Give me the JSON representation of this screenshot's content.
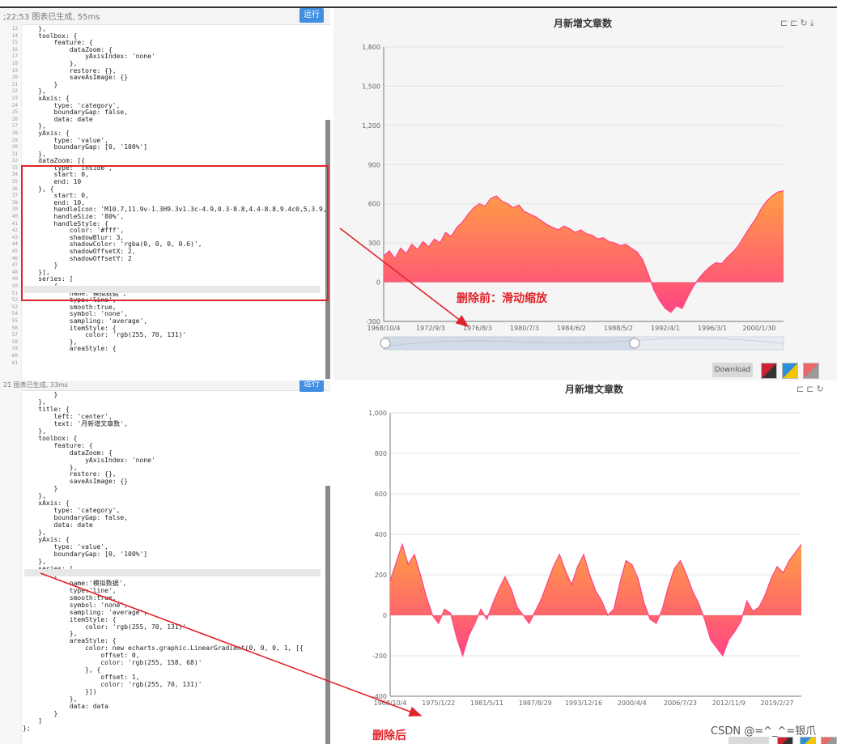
{
  "top_editor": {
    "status": ";22;53  图表已生成, 55ms",
    "run_label": "运行",
    "lines": [
      "    },",
      "    toolbox: {",
      "        feature: {",
      "            dataZoom: {",
      "                yAxisIndex: 'none'",
      "            },",
      "            restore: {},",
      "            saveAsImage: {}",
      "        }",
      "    },",
      "    xAxis: {",
      "        type: 'category',",
      "        boundaryGap: false,",
      "        data: date",
      "    },",
      "    yAxis: {",
      "        type: 'value',",
      "        boundaryGap: [0, '100%']",
      "    },",
      "    dataZoom: [{",
      "        type: 'inside',",
      "        start: 0,",
      "        end: 10",
      "    }, {",
      "        start: 0,",
      "        end: 10,",
      "        handleIcon: 'M10.7,11.9v-1.3H9.3v1.3c-4.9,0.3-8.8,4.4-8.8,9.4c0,5,3.9,9.1,8.8,9.",
      "        handleSize: '80%',",
      "        handleStyle: {",
      "            color: '#fff',",
      "            shadowBlur: 3,",
      "            shadowColor: 'rgba(0, 0, 0, 0.6)',",
      "            shadowOffsetX: 2,",
      "            shadowOffsetY: 2",
      "        }",
      "    }],",
      "    series: [",
      "        {",
      "            name:'模拟数据',",
      "            type:'line',",
      "            smooth:true,",
      "            symbol: 'none',",
      "            sampling: 'average',",
      "            itemStyle: {",
      "                color: 'rgb(255, 70, 131)'",
      "            },",
      "            areaStyle: {"
    ],
    "gutter": "13\n14\n15\n16\n17\n18\n19\n20\n21\n22\n23\n24\n25\n26\n27\n28\n29\n30\n31\n32\n33\n34\n35\n36\n37\n38\n39\n40\n41\n42\n43\n44\n45\n46\n47\n48\n49\n50\n51\n52\n53\n54\n55\n56\n57\n58\n59\n60\n61"
  },
  "bottom_editor": {
    "status": "21  图表已生成, 33ms",
    "run_label": "运行",
    "lines": [
      "        }",
      "    },",
      "    title: {",
      "        left: 'center',",
      "        text: '月新增文章数',",
      "    },",
      "    toolbox: {",
      "        feature: {",
      "            dataZoom: {",
      "                yAxisIndex: 'none'",
      "            },",
      "            restore: {},",
      "            saveAsImage: {}",
      "        }",
      "    },",
      "    xAxis: {",
      "        type: 'category',",
      "        boundaryGap: false,",
      "        data: date",
      "    },",
      "    yAxis: {",
      "        type: 'value',",
      "        boundaryGap: [0, '100%']",
      "    },",
      "    series: [",
      "        {",
      "            name:'模拟数据',",
      "            type:'line',",
      "            smooth:true,",
      "            symbol: 'none',",
      "            sampling: 'average',",
      "            itemStyle: {",
      "                color: 'rgb(255, 70, 131)'",
      "            },",
      "            areaStyle: {",
      "                color: new echarts.graphic.LinearGradient(0, 0, 0, 1, [{",
      "                    offset: 0,",
      "                    color: 'rgb(255, 158, 68)'",
      "                }, {",
      "                    offset: 1,",
      "                    color: 'rgb(255, 70, 131)'",
      "                }])",
      "            },",
      "            data: data",
      "        }",
      "    ]",
      "};"
    ]
  },
  "annotations": {
    "before": "删除前：滑动缩放",
    "after": "删除后"
  },
  "watermark": "CSDN @=^_^=银爪",
  "toolbar": {
    "download_label": "Download"
  },
  "colors": {
    "line": "#ff4683",
    "gradient_top": "#ff9e44",
    "gradient_bottom": "#ff4683",
    "annotation": "#e0242a",
    "run_button": "#3f8ee0"
  },
  "chart_data": [
    {
      "type": "area",
      "title": "月新增文章数",
      "ylim": [
        -300,
        1800
      ],
      "yticks": [
        -300,
        0,
        300,
        600,
        900,
        1200,
        1500,
        1800
      ],
      "ytick_labels": [
        "-300",
        "0",
        "300",
        "600",
        "900",
        "1,200",
        "1,500",
        "1,800"
      ],
      "xtick_labels": [
        "1968/10/4",
        "1972/9/3",
        "1976/8/3",
        "1980/7/3",
        "1984/6/2",
        "1988/5/2",
        "1992/4/1",
        "1996/3/1",
        "2000/1/30"
      ],
      "datazoom": {
        "start": 0,
        "end": 10
      },
      "values": [
        200,
        240,
        180,
        260,
        220,
        290,
        250,
        310,
        270,
        330,
        300,
        380,
        350,
        420,
        460,
        520,
        570,
        600,
        580,
        640,
        660,
        620,
        600,
        570,
        590,
        540,
        520,
        500,
        470,
        440,
        420,
        400,
        430,
        410,
        380,
        400,
        370,
        360,
        330,
        340,
        310,
        300,
        280,
        290,
        260,
        230,
        170,
        60,
        -60,
        -140,
        -200,
        -230,
        -180,
        -200,
        -110,
        -30,
        30,
        80,
        120,
        150,
        140,
        190,
        230,
        280,
        350,
        420,
        480,
        560,
        620,
        660,
        690,
        700
      ]
    },
    {
      "type": "area",
      "title": "月新增文章数",
      "ylim": [
        -400,
        1000
      ],
      "yticks": [
        -400,
        -200,
        0,
        200,
        400,
        600,
        800,
        1000
      ],
      "ytick_labels": [
        "-400",
        "-200",
        "0",
        "200",
        "400",
        "600",
        "800",
        "1,000"
      ],
      "xtick_labels": [
        "1968/10/4",
        "1975/1/22",
        "1981/5/11",
        "1987/8/29",
        "1993/12/16",
        "2000/4/4",
        "2006/7/23",
        "2012/11/9",
        "2019/2/27"
      ],
      "values": [
        170,
        260,
        350,
        250,
        300,
        200,
        90,
        0,
        -40,
        30,
        10,
        -110,
        -200,
        -100,
        -40,
        30,
        -20,
        60,
        130,
        190,
        130,
        40,
        0,
        -40,
        20,
        80,
        160,
        240,
        300,
        220,
        150,
        240,
        300,
        200,
        120,
        70,
        0,
        30,
        160,
        270,
        250,
        180,
        60,
        -20,
        -40,
        30,
        140,
        230,
        270,
        200,
        120,
        60,
        -20,
        -120,
        -160,
        -200,
        -120,
        -80,
        -30,
        70,
        20,
        40,
        100,
        180,
        240,
        210,
        270,
        310,
        350
      ]
    }
  ]
}
